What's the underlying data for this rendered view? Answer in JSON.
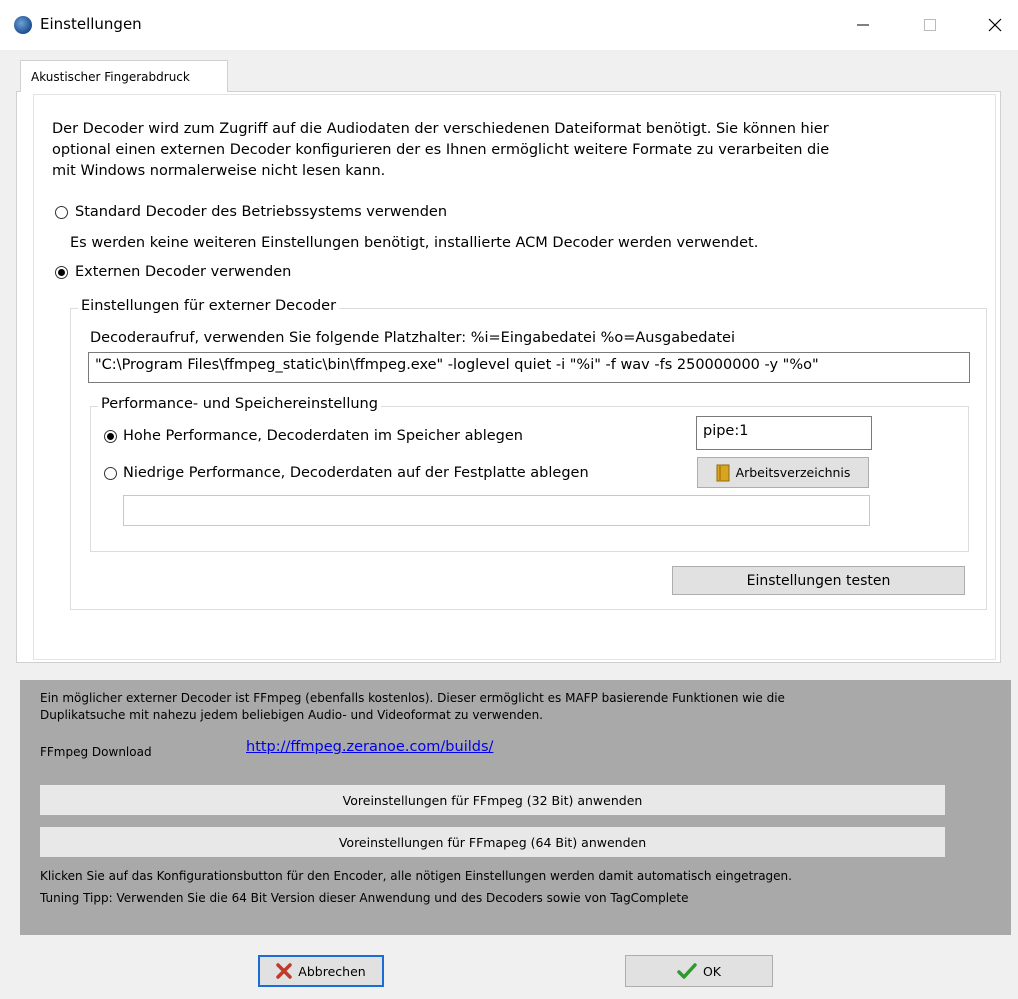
{
  "window": {
    "title": "Einstellungen"
  },
  "tabs": [
    {
      "label": "Akustischer Fingerabdruck"
    }
  ],
  "intro": {
    "line1": "Der Decoder wird zum Zugriff auf die Audiodaten der verschiedenen Dateiformat benötigt.  Sie können hier",
    "line2": "optional einen externen Decoder konfigurieren der es Ihnen ermöglicht weitere Formate zu verarbeiten die",
    "line3": "mit Windows normalerweise nicht lesen kann."
  },
  "decoder_options": {
    "standard_label": "Standard Decoder des Betriebssystems verwenden",
    "standard_checked": false,
    "standard_note": "Es werden keine weiteren Einstellungen benötigt, installierte ACM Decoder werden verwendet.",
    "external_label": "Externen Decoder verwenden",
    "external_checked": true
  },
  "external_settings": {
    "legend": "Einstellungen für externer Decoder",
    "call_label": "Decoderaufruf, verwenden Sie folgende Platzhalter: %i=Eingabedatei %o=Ausgabedatei",
    "command_value": "\"C:\\Program Files\\ffmpeg_static\\bin\\ffmpeg.exe\" -loglevel quiet -i \"%i\" -f wav -fs 250000000 -y \"%o\"",
    "test_button": "Einstellungen testen"
  },
  "performance": {
    "legend": "Performance- und Speichereinstellung",
    "high_label": "Hohe Performance, Decoderdaten im Speicher ablegen",
    "high_checked": true,
    "low_label": "Niedrige Performance, Decoderdaten auf der Festplatte ablegen",
    "low_checked": false,
    "pipe_value": "pipe:1",
    "workdir_button": "Arbeitsverzeichnis",
    "workdir_value": ""
  },
  "info": {
    "line1": "Ein möglicher externer Decoder ist FFmpeg (ebenfalls kostenlos). Dieser ermöglicht es MAFP basierende Funktionen wie die",
    "line2": "Duplikatsuche mit nahezu jedem beliebigen Audio- und Videoformat zu verwenden.",
    "download_label": "FFmpeg Download",
    "download_link": "http://ffmpeg.zeranoe.com/builds/",
    "preset32_button": "Voreinstellungen für FFmpeg (32 Bit) anwenden",
    "preset64_button": "Voreinstellungen für FFmapeg (64 Bit) anwenden",
    "hint1": "Klicken Sie auf das Konfigurationsbutton für den Encoder, alle nötigen Einstellungen werden damit automatisch eingetragen.",
    "hint2": "Tuning Tipp: Verwenden Sie die 64 Bit Version dieser Anwendung und des Decoders sowie von TagComplete"
  },
  "footer": {
    "cancel_button": "Abbrechen",
    "ok_button": "OK"
  },
  "colors": {
    "info_background": "#a9a9a9",
    "link": "#0000ee",
    "focus_border": "#1a6dd6",
    "ok_check": "#2e9a2e",
    "cancel_x": "#c0392b"
  }
}
